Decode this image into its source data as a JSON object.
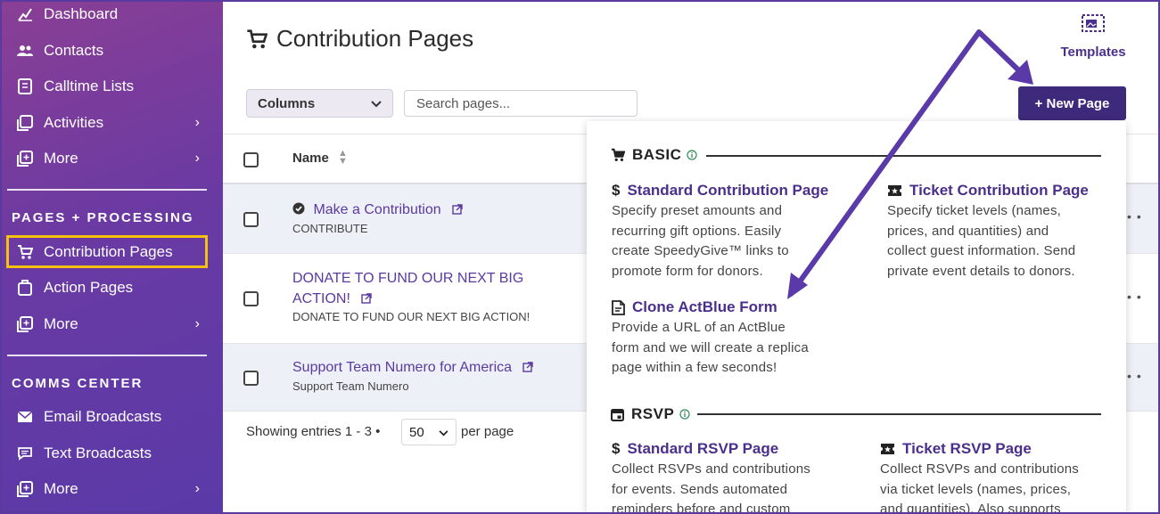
{
  "sidebar": {
    "top_items": [
      {
        "label": "Dashboard"
      },
      {
        "label": "Contacts"
      },
      {
        "label": "Calltime Lists"
      },
      {
        "label": "Activities"
      },
      {
        "label": "More"
      }
    ],
    "pages_section": {
      "title": "PAGES + PROCESSING",
      "items": [
        {
          "label": "Contribution Pages",
          "active": true
        },
        {
          "label": "Action Pages"
        },
        {
          "label": "More"
        }
      ]
    },
    "comms_section": {
      "title": "COMMS CENTER",
      "items": [
        {
          "label": "Email Broadcasts"
        },
        {
          "label": "Text Broadcasts"
        },
        {
          "label": "More"
        }
      ]
    },
    "active_highlight_color": "#f4c20d"
  },
  "header": {
    "title": "Contribution Pages",
    "templates_label": "Templates"
  },
  "toolbar": {
    "columns_label": "Columns",
    "search_placeholder": "Search pages...",
    "new_page_label": "+ New Page"
  },
  "table": {
    "name_header": "Name",
    "rows": [
      {
        "title": "Make a Contribution",
        "subtitle": "CONTRIBUTE",
        "verified": true
      },
      {
        "title_line1": "DONATE TO FUND OUR NEXT BIG",
        "title_line2": "ACTION!",
        "subtitle": "DONATE TO FUND OUR NEXT BIG ACTION!"
      },
      {
        "title": "Support Team Numero for America",
        "subtitle": "Support Team Numero"
      }
    ],
    "showing_text": "Showing entries 1 - 3 •",
    "per_page_value": "50",
    "per_page_label": "per page"
  },
  "dropdown": {
    "basic": {
      "title": "BASIC",
      "options": [
        {
          "title": "Standard Contribution Page",
          "icon": "dollar-icon",
          "desc": [
            "Specify preset amounts and",
            "recurring gift options. Easily",
            "create SpeedyGive™ links to",
            "promote form for donors."
          ]
        },
        {
          "title": "Ticket Contribution Page",
          "icon": "ticket-icon",
          "desc": [
            "Specify ticket levels (names,",
            "prices, and quantities) and",
            "collect guest information. Send",
            "private event details to donors."
          ]
        },
        {
          "title": "Clone ActBlue Form",
          "icon": "document-icon",
          "desc": [
            "Provide a URL of an ActBlue",
            "form and we will create a replica",
            "page within a few seconds!"
          ]
        }
      ]
    },
    "rsvp": {
      "title": "RSVP",
      "options": [
        {
          "title": "Standard RSVP Page",
          "icon": "dollar-icon",
          "desc": [
            "Collect RSVPs and contributions",
            "for events. Sends automated",
            "reminders before and custom"
          ]
        },
        {
          "title": "Ticket RSVP Page",
          "icon": "ticket-icon",
          "desc": [
            "Collect RSVPs and contributions",
            "via ticket levels (names, prices,",
            "and quantities). Also supports"
          ]
        }
      ]
    }
  },
  "colors": {
    "brand_purple": "#3e2a7a",
    "link_purple": "#5a3aa0",
    "annotation_arrow": "#5a3aa8",
    "info_green": "#2e8b57"
  }
}
